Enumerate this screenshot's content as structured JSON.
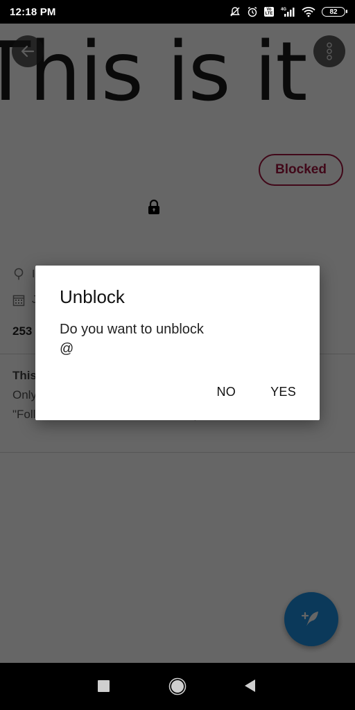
{
  "status_bar": {
    "time": "12:18 PM",
    "icons": [
      "notifications-off-icon",
      "alarm-icon",
      "volte-icon",
      "signal-4g-icon",
      "wifi-icon",
      "battery-icon"
    ],
    "network_label": "4G",
    "volte_top": "Vo",
    "volte_bottom": "LTE",
    "battery_level": "82"
  },
  "profile": {
    "cover_text": "This is it",
    "blocked_label": "Blocked",
    "location_partial": "I",
    "joined_partial": "J",
    "counts_partial": "253",
    "private_title": "This account is private",
    "private_body": "Only approved followers can see Mehmet's posts. Tap the \"Follow\" button to send a follow request."
  },
  "dialog": {
    "title": "Unblock",
    "message_line1": "Do you want to unblock",
    "message_line2": "@",
    "no_label": "NO",
    "yes_label": "YES"
  },
  "fab": {
    "icon": "compose-feather-icon"
  },
  "nav_bar": {
    "items": [
      "recents-icon",
      "home-icon",
      "back-icon"
    ]
  },
  "colors": {
    "blocked": "#a3163f",
    "fab": "#1d8fe1"
  }
}
